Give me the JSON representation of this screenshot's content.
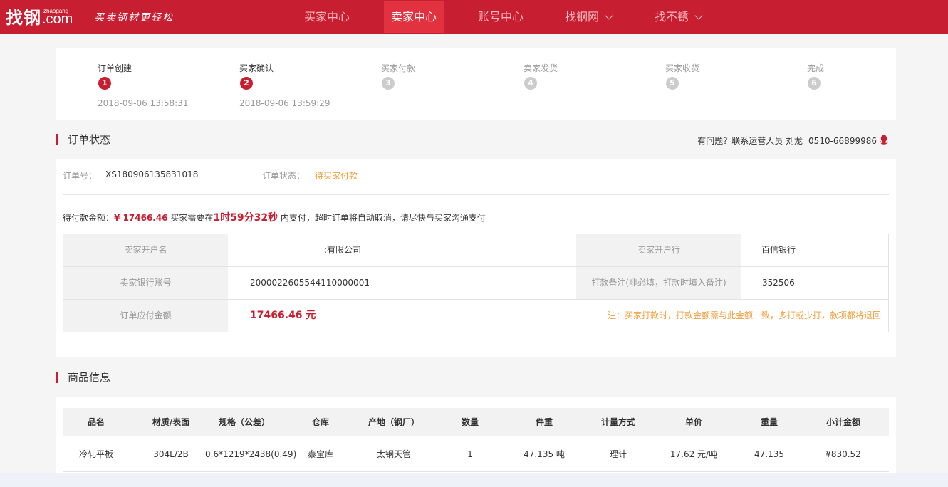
{
  "header": {
    "logo_cn": "找钢",
    "logo_pinyin": "zhaogang",
    "logo_com": ".com",
    "slogan": "买卖钢材更轻松",
    "nav": [
      {
        "label": "买家中心",
        "active": false,
        "dropdown": false
      },
      {
        "label": "卖家中心",
        "active": true,
        "dropdown": false
      },
      {
        "label": "账号中心",
        "active": false,
        "dropdown": false
      },
      {
        "label": "找钢网",
        "active": false,
        "dropdown": true
      },
      {
        "label": "找不锈",
        "active": false,
        "dropdown": true
      }
    ],
    "brand_color": "#c81e31"
  },
  "progress": {
    "steps": [
      {
        "label": "订单创建",
        "num": "1",
        "done": true,
        "time": "2018-09-06 13:58:31"
      },
      {
        "label": "买家确认",
        "num": "2",
        "done": true,
        "time": "2018-09-06 13:59:29"
      },
      {
        "label": "买家付款",
        "num": "3",
        "done": false,
        "time": ""
      },
      {
        "label": "卖家发货",
        "num": "4",
        "done": false,
        "time": ""
      },
      {
        "label": "买家收货",
        "num": "5",
        "done": false,
        "time": ""
      },
      {
        "label": "完成",
        "num": "6",
        "done": false,
        "time": ""
      }
    ]
  },
  "order_status": {
    "section_title": "订单状态",
    "contact_text": "有问题？联系运营人员 刘龙",
    "contact_phone": "0510-66899986",
    "order_no_label": "订单号：",
    "order_no": "XS180906135831018",
    "status_label": "订单状态：",
    "status_value": "待买家付款",
    "pay_prefix": "待付款金额：",
    "pay_amount": "¥ 17466.46",
    "pay_mid": " 买家需要在",
    "pay_time": "1时59分32秒",
    "pay_suffix": " 内支付，超时订单将自动取消，请尽快与买家沟通支付",
    "table": {
      "seller_account_name_label": "卖家开户名",
      "seller_account_name": ":有限公司",
      "seller_bank_label": "卖家开户行",
      "seller_bank": "百信银行",
      "seller_account_no_label": "卖家银行账号",
      "seller_account_no": "2000022605544110000001",
      "remark_label": "打款备注(非必填，打款时填入备注)",
      "remark": "352506",
      "payable_label": "订单应付金额",
      "payable": "17466.46 元",
      "payable_note": "注：买家打款时，打款金额需与此金额一致，多打或少打，款项都将退回"
    }
  },
  "goods": {
    "section_title": "商品信息",
    "headers": [
      "品名",
      "材质/表面",
      "规格（公差）",
      "仓库",
      "产地（钢厂）",
      "数量",
      "件重",
      "计量方式",
      "单价",
      "重量",
      "小计金额"
    ],
    "rows": [
      [
        "冷轧平板",
        "304L/2B",
        "0.6*1219*2438(0.49)",
        "泰宝库",
        "太钢天管",
        "1",
        "47.135 吨",
        "理计",
        "17.62 元/吨",
        "47.135",
        "¥830.52"
      ]
    ]
  }
}
